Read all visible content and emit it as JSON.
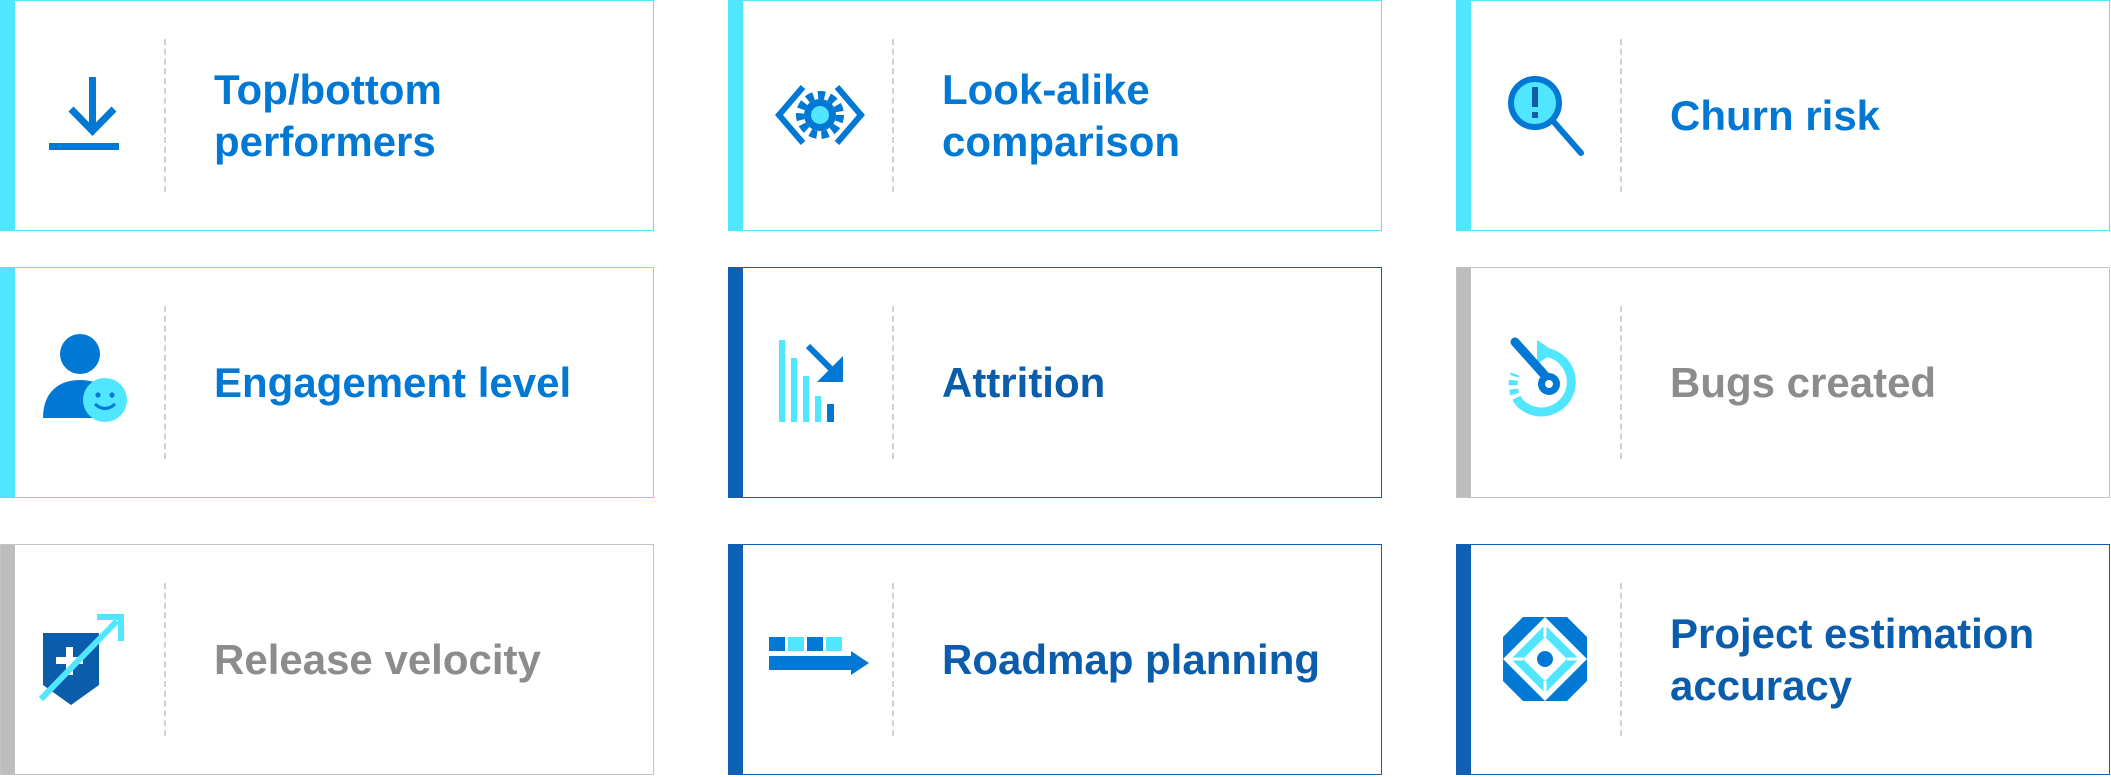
{
  "colors": {
    "light_accent": "#50e6ff",
    "dark_accent": "#0f5fb5",
    "gray_accent": "#bdbdbd",
    "text_blue": "#0078d4",
    "text_dark_blue": "#0b5cab",
    "text_gray": "#8c8c8c"
  },
  "cards": [
    {
      "label": "Top/bottom\nperformers",
      "icon": "download-icon",
      "theme": "light"
    },
    {
      "label": "Look-alike\ncomparison",
      "icon": "code-gear-icon",
      "theme": "light"
    },
    {
      "label": "Churn risk",
      "icon": "alert-magnifier-icon",
      "theme": "light"
    },
    {
      "label": "Engagement level",
      "icon": "person-smile-icon",
      "theme": "light"
    },
    {
      "label": "Attrition",
      "icon": "declining-bars-icon",
      "theme": "dark"
    },
    {
      "label": "Bugs created",
      "icon": "wrench-refresh-icon",
      "theme": "gray"
    },
    {
      "label": "Release velocity",
      "icon": "shield-arrow-icon",
      "theme": "gray"
    },
    {
      "label": "Roadmap planning",
      "icon": "roadmap-arrow-icon",
      "theme": "dark"
    },
    {
      "label": "Project estimation\naccuracy",
      "icon": "diamond-target-icon",
      "theme": "dark"
    }
  ]
}
